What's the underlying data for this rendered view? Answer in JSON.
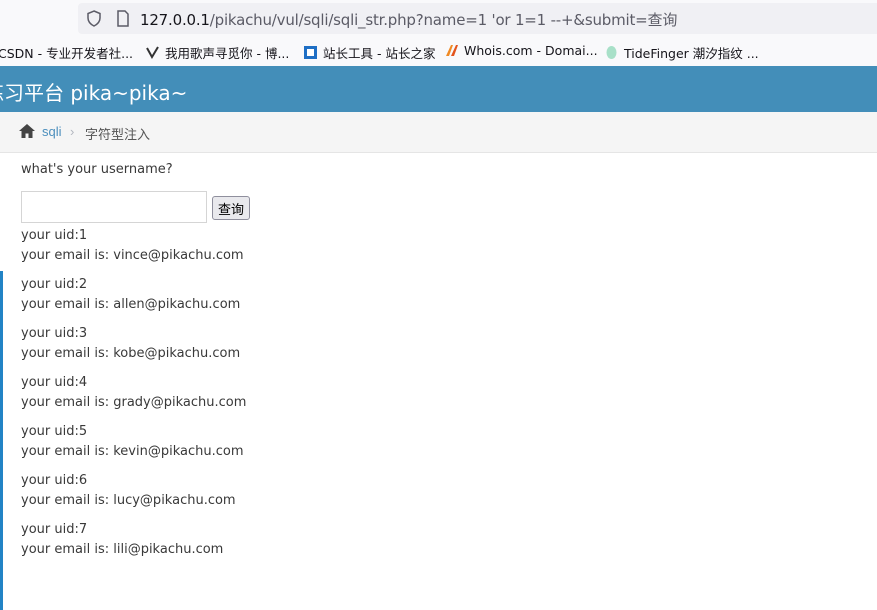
{
  "browser": {
    "url_host": "127.0.0.1",
    "url_path": "/pikachu/vul/sqli/sqli_str.php?name=1 'or 1=1 --+&submit=查询",
    "bookmarks": [
      {
        "label": "CSDN - 专业开发者社...",
        "icon": "csdn-icon",
        "color": "#ffffff"
      },
      {
        "label": "我用歌声寻觅你 - 博...",
        "icon": "blog-icon",
        "color": "#ffffff"
      },
      {
        "label": "站长工具 - 站长之家",
        "icon": "chinaz-icon",
        "color": "#1f6fc5"
      },
      {
        "label": "Whois.com - Domai...",
        "icon": "whois-icon",
        "color": "#f08a24"
      },
      {
        "label": "TideFinger 潮汐指纹 ...",
        "icon": "tidefinger-icon",
        "color": "#a8e0c8"
      }
    ]
  },
  "app": {
    "title": "练习平台 pika~pika~",
    "header_color": "#438eb9"
  },
  "breadcrumb": {
    "link": "sqli",
    "separator": "›",
    "current": "字符型注入"
  },
  "form": {
    "prompt": "what's your username?",
    "input_value": "",
    "submit_label": "查询"
  },
  "results": [
    {
      "uid": "your uid:1",
      "email": "your email is: vince@pikachu.com"
    },
    {
      "uid": "your uid:2",
      "email": "your email is: allen@pikachu.com"
    },
    {
      "uid": "your uid:3",
      "email": "your email is: kobe@pikachu.com"
    },
    {
      "uid": "your uid:4",
      "email": "your email is: grady@pikachu.com"
    },
    {
      "uid": "your uid:5",
      "email": "your email is: kevin@pikachu.com"
    },
    {
      "uid": "your uid:6",
      "email": "your email is: lucy@pikachu.com"
    },
    {
      "uid": "your uid:7",
      "email": "your email is: lili@pikachu.com"
    }
  ]
}
